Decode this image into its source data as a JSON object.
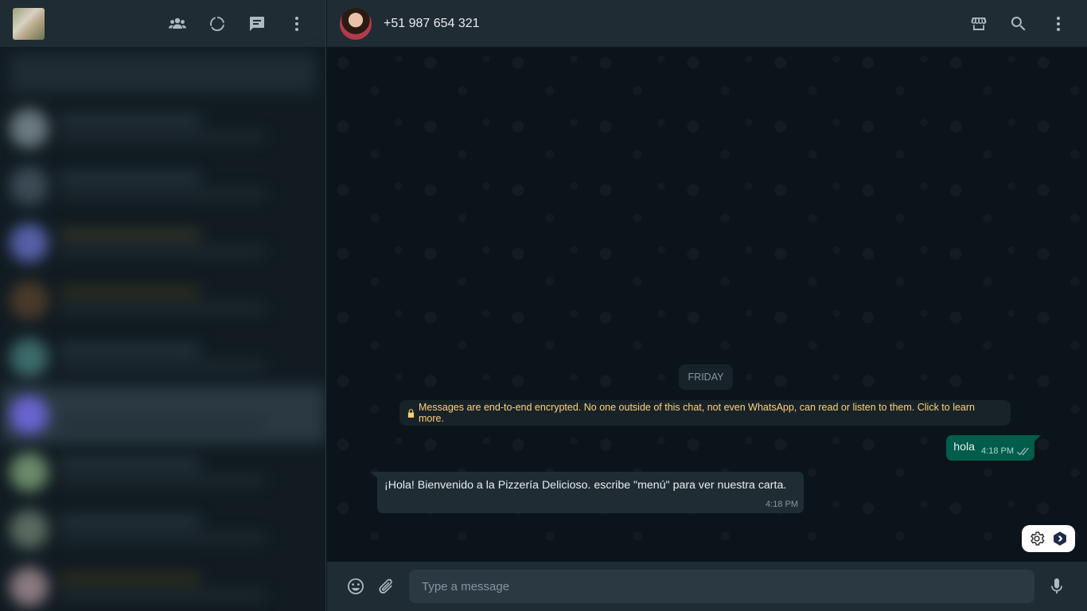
{
  "left_header": {
    "icons": [
      "communities-icon",
      "status-icon",
      "new-chat-icon",
      "menu-icon"
    ]
  },
  "chat": {
    "contact_name": "+51 987 654 321",
    "header_icons": [
      "catalog-icon",
      "search-icon",
      "menu-icon"
    ],
    "date_divider": "FRIDAY",
    "encryption_notice": "Messages are end-to-end encrypted. No one outside of this chat, not even WhatsApp, can read or listen to them. Click to learn more.",
    "messages": [
      {
        "direction": "outgoing",
        "text": "hola",
        "time": "4:18 PM",
        "status": "read"
      },
      {
        "direction": "incoming",
        "text": "¡Hola! Bienvenido a la Pizzería Delicioso. escribe \"menú\" para ver nuestra carta.",
        "time": "4:18 PM"
      }
    ]
  },
  "composer": {
    "placeholder": "Type a message",
    "icons": [
      "emoji-icon",
      "attach-icon",
      "mic-icon"
    ]
  },
  "floating_tools": [
    "settings-gear-icon",
    "extension-logo-icon"
  ],
  "colors": {
    "header_bg": "#202c33",
    "panel_bg": "#111b21",
    "outgoing_bubble": "#005c4b",
    "incoming_bubble": "#202c33",
    "notice_text": "#ffd279"
  }
}
